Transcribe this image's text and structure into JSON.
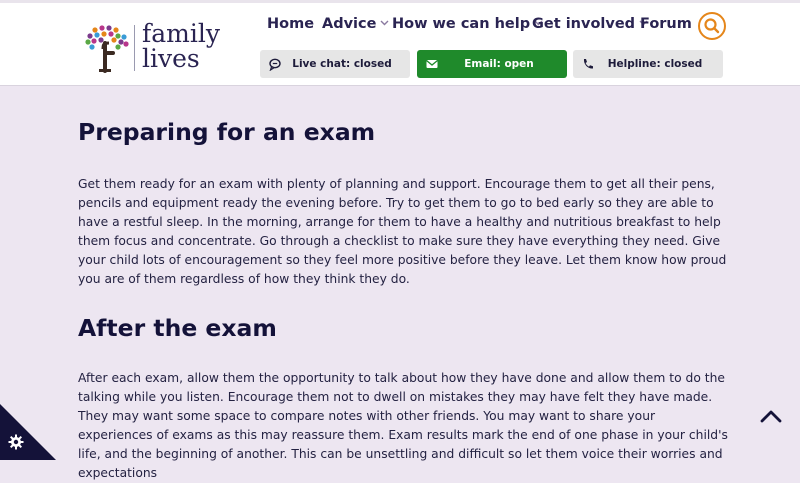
{
  "brand": {
    "line1": "family",
    "line2": "lives"
  },
  "nav": {
    "items": [
      {
        "label": "Home",
        "dropdown": false
      },
      {
        "label": "Advice",
        "dropdown": true
      },
      {
        "label": "How we can help",
        "dropdown": true
      },
      {
        "label": "Get involved",
        "dropdown": true
      },
      {
        "label": "Forum",
        "dropdown": false
      }
    ],
    "search_icon": "search-icon"
  },
  "contact": {
    "live_chat": {
      "label": "Live chat: closed",
      "icon": "chat-icon",
      "status": "closed"
    },
    "email": {
      "label": "Email: open",
      "icon": "envelope-icon",
      "status": "open"
    },
    "helpline": {
      "label": "Helpline: closed",
      "icon": "phone-icon",
      "status": "closed"
    }
  },
  "article": {
    "section1": {
      "heading": "Preparing for an exam",
      "body": "Get them ready for an exam with plenty of planning and support. Encourage them to get all their pens, pencils and equipment ready the evening before. Try to get them to go to bed early so they are able to have a restful sleep. In the morning, arrange for them to have a healthy and nutritious breakfast to help them focus and concentrate. Go through a checklist to make sure they have everything they need. Give your child lots of encouragement so they feel more positive before they leave. Let them know how proud you are of them regardless of how they think they do."
    },
    "section2": {
      "heading": "After the exam",
      "body": "After each exam, allow them the opportunity to talk about how they have done and allow them to do the talking while you listen. Encourage them not to dwell on mistakes they may have felt they have made. They may want some space to compare notes with other friends. You may want to share your experiences of exams as this may reassure them. Exam results mark the end of one phase in your child's life, and the beginning of another. This can be unsettling and difficult so let them voice their worries and expectations"
    }
  },
  "colors": {
    "accent": "#e5861a",
    "email_open": "#1f8a2b",
    "navy": "#141239",
    "page_bg": "#ede6f1"
  }
}
